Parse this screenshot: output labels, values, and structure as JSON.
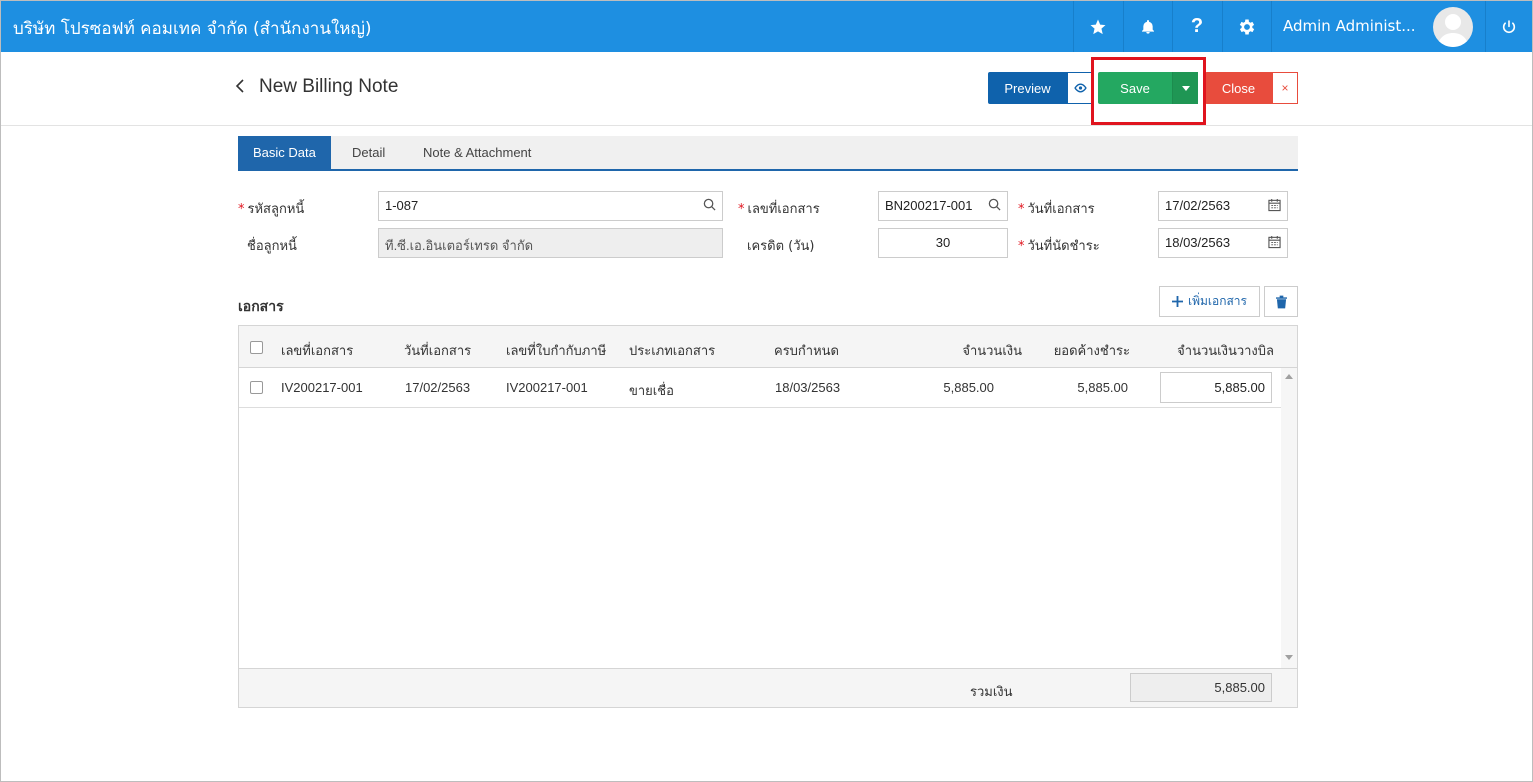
{
  "topbar": {
    "company": "บริษัท โปรซอฟท์ คอมเทค จำกัด (สำนักงานใหญ่)",
    "user_name": "Admin Administ...",
    "icons": [
      "star-icon",
      "bell-icon",
      "help-icon",
      "gear-icon",
      "avatar",
      "power-icon"
    ]
  },
  "header": {
    "title": "New Billing Note",
    "preview_label": "Preview",
    "save_label": "Save",
    "close_label": "Close"
  },
  "tabs": [
    {
      "label": "Basic Data",
      "active": true
    },
    {
      "label": "Detail",
      "active": false
    },
    {
      "label": "Note & Attachment",
      "active": false
    }
  ],
  "form": {
    "customer_code_label": "รหัสลูกหนี้",
    "customer_code": "1-087",
    "customer_name_label": "ชื่อลูกหนี้",
    "customer_name": "ที.ซี.เอ.อินเตอร์เทรด จำกัด",
    "doc_no_label": "เลขที่เอกสาร",
    "doc_no": "BN200217-001",
    "credit_label": "เครดิต (วัน)",
    "credit": "30",
    "doc_date_label": "วันที่เอกสาร",
    "doc_date": "17/02/2563",
    "due_date_label": "วันที่นัดชำระ",
    "due_date": "18/03/2563"
  },
  "documents": {
    "section_title": "เอกสาร",
    "add_label": "เพิ่มเอกสาร",
    "columns": [
      "เลขที่เอกสาร",
      "วันที่เอกสาร",
      "เลขที่ใบกำกับภาษี",
      "ประเภทเอกสาร",
      "ครบกำหนด",
      "จำนวนเงิน",
      "ยอดค้างชำระ",
      "จำนวนเงินวางบิล"
    ],
    "rows": [
      {
        "doc_no": "IV200217-001",
        "doc_date": "17/02/2563",
        "tax_no": "IV200217-001",
        "doc_type": "ขายเชื่อ",
        "due": "18/03/2563",
        "amount": "5,885.00",
        "outstanding": "5,885.00",
        "billing_amount": "5,885.00"
      }
    ],
    "total_label": "รวมเงิน",
    "total": "5,885.00"
  },
  "colors": {
    "topbar": "#1e8fe1",
    "preview": "#0f62ac",
    "save": "#24a861",
    "close": "#e84c3d",
    "highlight": "#e0141e"
  }
}
